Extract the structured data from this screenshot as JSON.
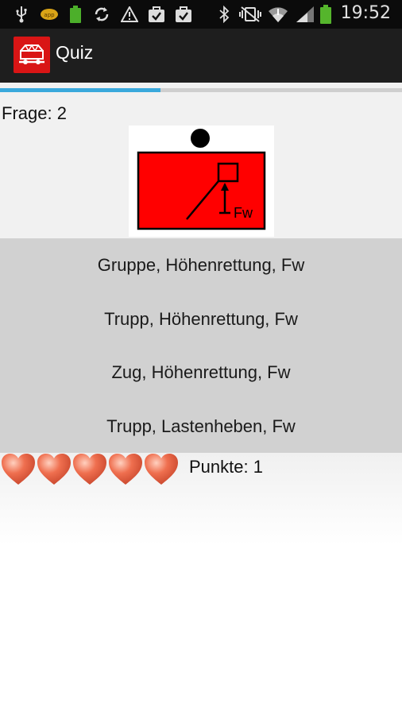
{
  "status_bar": {
    "time": "19:52",
    "icons": [
      "usb-icon",
      "notification-badge-icon",
      "battery-small-icon",
      "sync-icon",
      "warning-icon",
      "bag-check-icon",
      "bag-check-icon",
      "bluetooth-icon",
      "vibrate-mute-icon",
      "wifi-icon",
      "signal-icon",
      "battery-icon"
    ]
  },
  "app_bar": {
    "title": "Quiz",
    "icon": "fire-truck-logo"
  },
  "progress": {
    "fraction": 0.4,
    "color": "#3aa9dc"
  },
  "question": {
    "label": "Frage: 2",
    "sign_text": "Fw",
    "sign_color": "#ff0000"
  },
  "answers": [
    {
      "label": "Gruppe, Höhenrettung, Fw"
    },
    {
      "label": "Trupp, Höhenrettung, Fw"
    },
    {
      "label": "Zug, Höhenrettung, Fw"
    },
    {
      "label": "Trupp, Lastenheben, Fw"
    }
  ],
  "lives": {
    "count": 5,
    "icon": "heart-icon",
    "color": "#ef6f4f"
  },
  "score": {
    "label": "Punkte: 1"
  }
}
